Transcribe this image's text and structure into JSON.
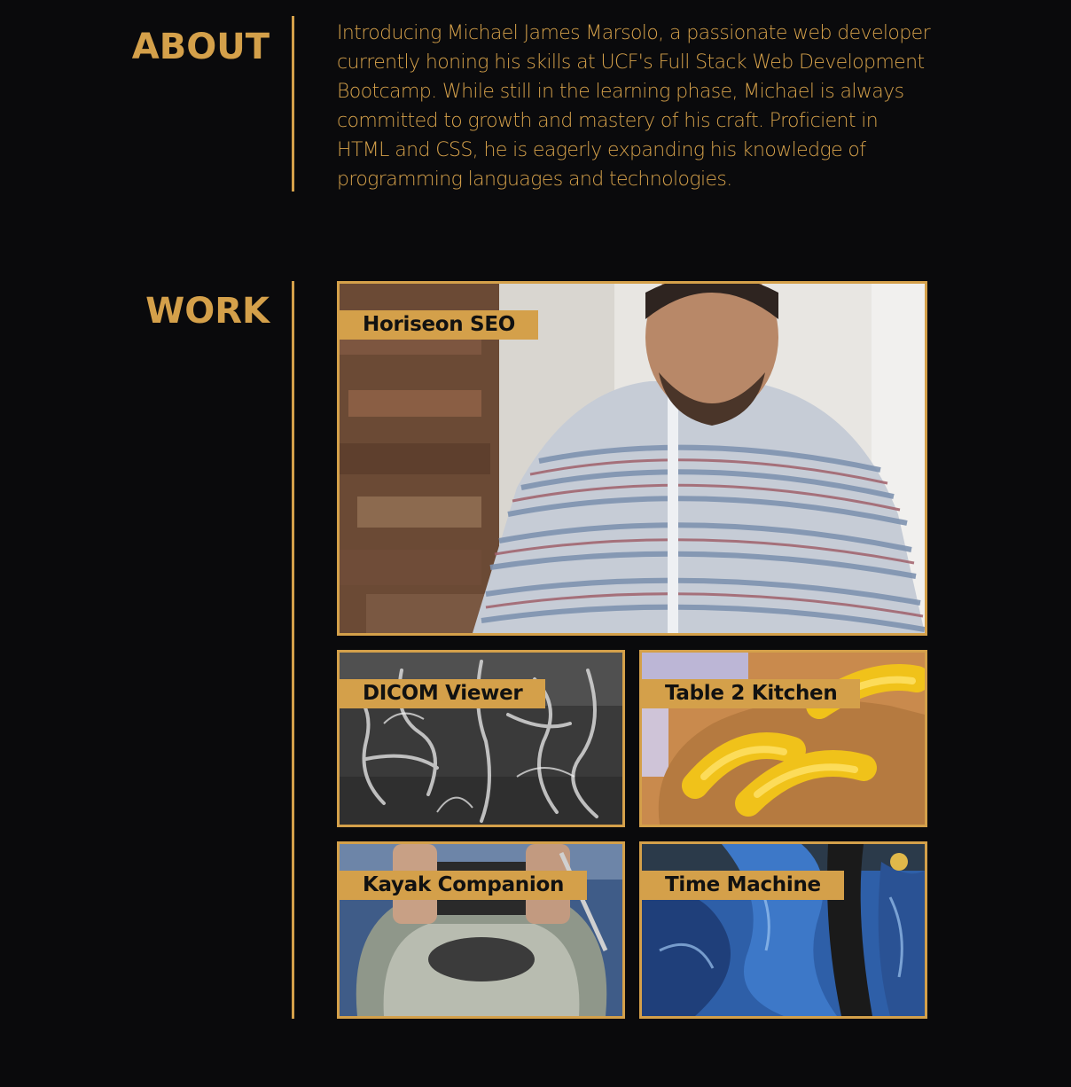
{
  "about": {
    "title": "ABOUT",
    "text": "Introducing Michael James Marsolo, a passionate web developer currently honing his skills at UCF's Full Stack Web Development Bootcamp. While still in the learning phase, Michael is always committed to growth and mastery of his craft. Proficient in HTML and CSS, he is eagerly expanding his knowledge of programming languages and technologies."
  },
  "work": {
    "title": "WORK",
    "projects": [
      {
        "label": "Horiseon SEO",
        "image": "man-in-striped-shirt-photo"
      },
      {
        "label": "DICOM Viewer",
        "image": "brain-scan-image"
      },
      {
        "label": "Table 2 Kitchen",
        "image": "mustard-on-bread-photo"
      },
      {
        "label": "Kayak Companion",
        "image": "kayak-photo"
      },
      {
        "label": "Time Machine",
        "image": "blue-painting-image"
      }
    ]
  },
  "colors": {
    "accent": "#d4a04a",
    "background": "#0a0a0c",
    "label_text": "#111111"
  }
}
